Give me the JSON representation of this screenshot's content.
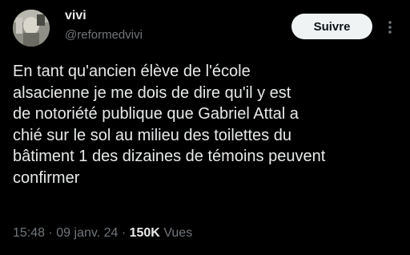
{
  "author": {
    "display_name": "vivi",
    "handle": "@reformedvivi"
  },
  "actions": {
    "follow_label": "Suivre",
    "more_icon": "more-vertical-icon"
  },
  "tweet": {
    "lines": [
      "En tant qu'ancien élève de l'école",
      "alsacienne je me dois de dire qu'il y est",
      "de notoriété publique que Gabriel Attal a",
      "chié sur le sol au milieu des toilettes du",
      "bâtiment 1 des dizaines de témoins peuvent",
      "confirmer"
    ]
  },
  "meta": {
    "time": "15:48",
    "separator": "·",
    "date": "09 janv. 24",
    "views_count": "150K",
    "views_label": "Vues"
  },
  "colors": {
    "background": "#000000",
    "text_primary": "#e7e9ea",
    "text_secondary": "#71767b",
    "button_bg": "#eff3f4",
    "button_text": "#0f1419"
  }
}
